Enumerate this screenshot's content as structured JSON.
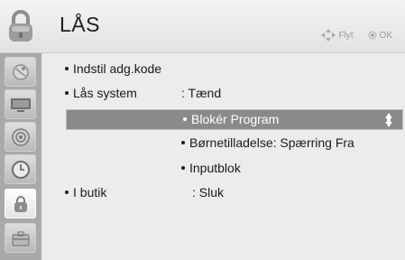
{
  "header": {
    "title": "LÅS",
    "hint_move": "Flyt",
    "hint_ok": "OK"
  },
  "sidebar": {
    "items": [
      {
        "icon": "satellite-dish-icon"
      },
      {
        "icon": "tv-screen-icon"
      },
      {
        "icon": "speaker-icon"
      },
      {
        "icon": "clock-icon"
      },
      {
        "icon": "lock-icon",
        "active": true
      },
      {
        "icon": "toolbox-icon"
      }
    ]
  },
  "menu": {
    "set_password": "Indstil adg.kode",
    "lock_system_label": "Lås system",
    "lock_system_value": ": Tænd",
    "block_program": "Blokér Program",
    "parental_guidance": "Børnetilladelse: Spærring Fra",
    "input_block": "Inputblok",
    "store_mode_label": "I butik",
    "store_mode_value": ": Sluk"
  },
  "colors": {
    "selection": "#8a8a8a",
    "sidebar": "#a9a9a9",
    "content_bg": "#ececec"
  }
}
